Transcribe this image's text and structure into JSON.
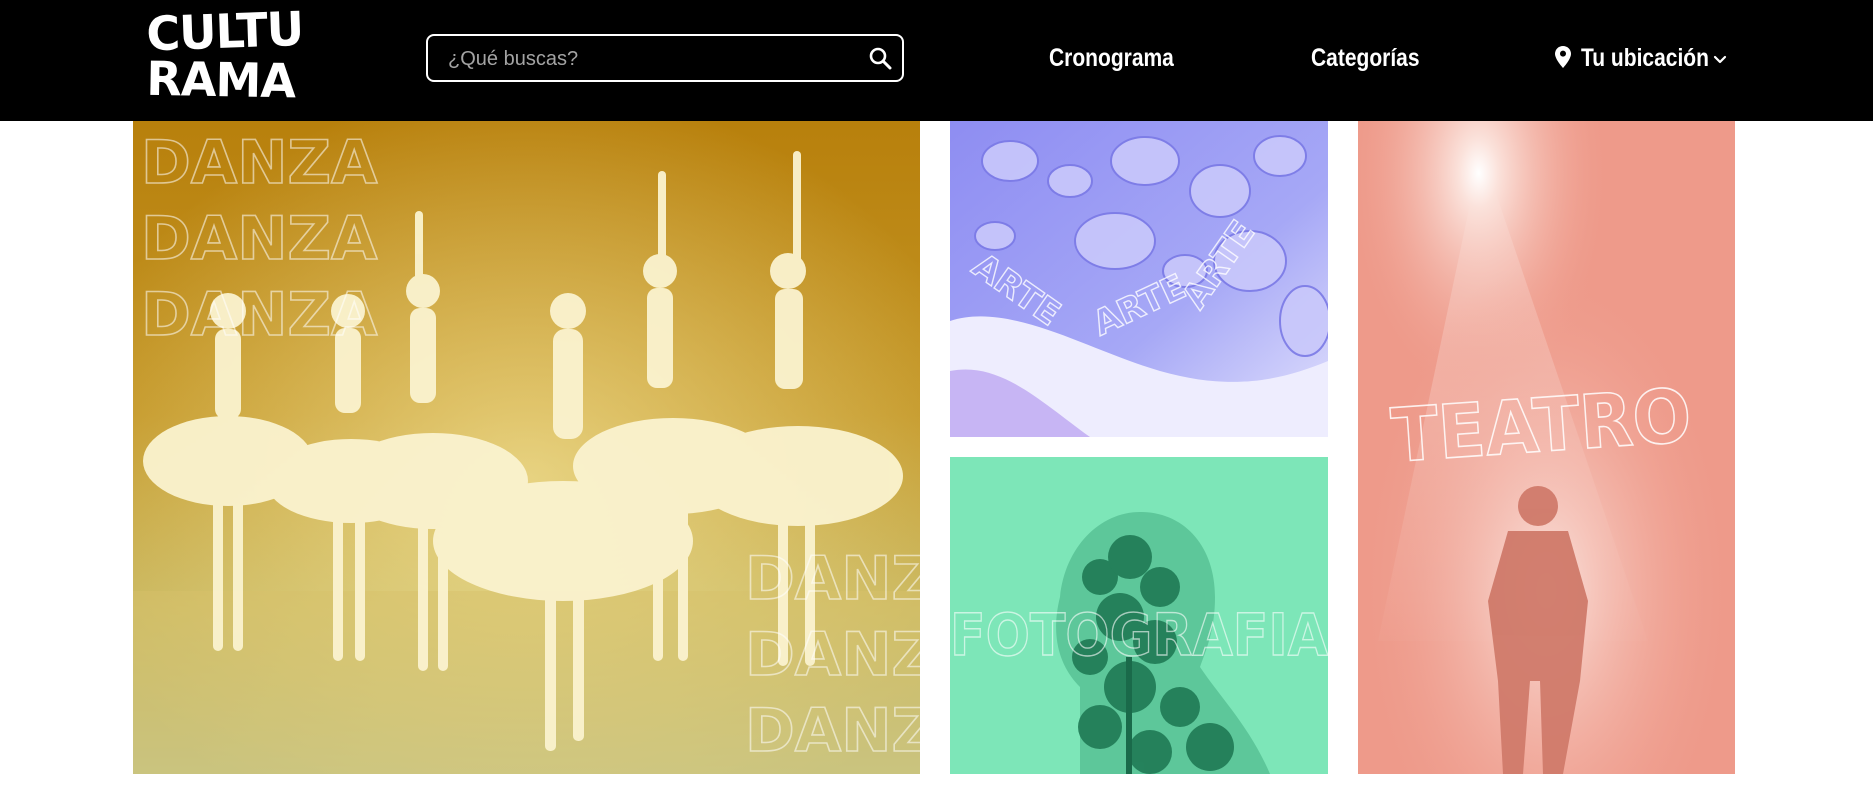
{
  "header": {
    "logo": {
      "line1": "CULTU",
      "line2": "RAMA"
    },
    "search": {
      "placeholder": "¿Qué buscas?",
      "value": ""
    },
    "nav": {
      "schedule_label": "Cronograma",
      "categories_label": "Categorías",
      "location_label": "Tu ubicación"
    }
  },
  "tiles": {
    "dance": {
      "word": "DANZA",
      "overlay_color": "#c99a1a"
    },
    "art": {
      "word": "ARTE",
      "overlay_color": "#a7a6f5"
    },
    "photo": {
      "word": "FOTOGRAFIA",
      "overlay_color": "#78e4b6"
    },
    "theater": {
      "word": "TEATRO",
      "overlay_color": "#ef9c8c"
    }
  },
  "icons": {
    "search": "search-icon",
    "location": "map-pin-icon",
    "dropdown": "chevron-down-icon"
  }
}
